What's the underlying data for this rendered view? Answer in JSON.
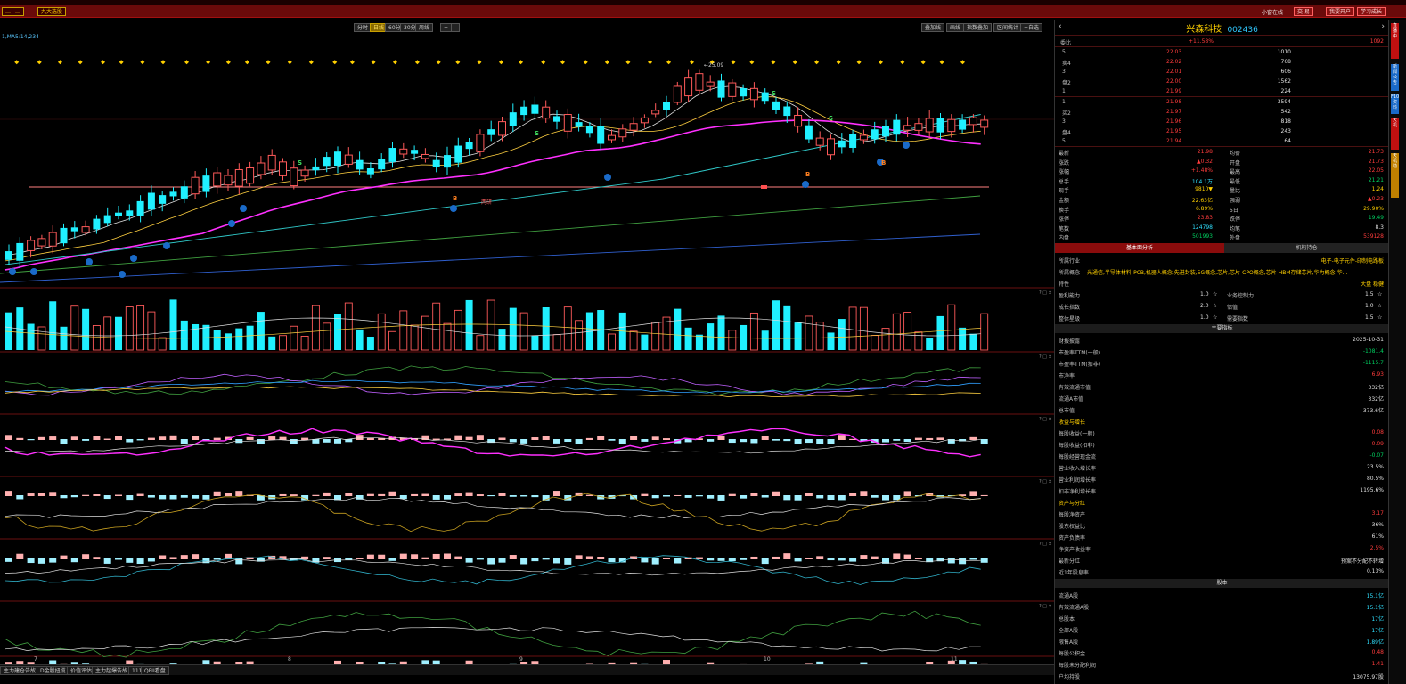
{
  "toolbar": {
    "left_buttons": [
      "…",
      "…",
      "九大选股"
    ],
    "right_status": "小窗在线",
    "right_buttons": [
      "交 易",
      "我要开户",
      "学习成长"
    ]
  },
  "chart_toolbar": {
    "periods": [
      "分时",
      "日线",
      "60分",
      "30分",
      "周线"
    ],
    "active_period": "日线",
    "zoom_in": "+",
    "zoom_out": "-",
    "right_buttons": [
      "叠加线",
      "画线",
      "指数叠加",
      "区间统计",
      "+自选"
    ],
    "ma_label": "1,MA5:14,234",
    "peak_label": "25.09"
  },
  "bottom_tabs": [
    "主力建仓告故",
    "D金股扭缆",
    "价值评估",
    "主力起爆告故",
    "111",
    "QFII看盘"
  ],
  "dates": [
    "7",
    "8",
    "9",
    "10",
    "11"
  ],
  "annotation": "两研",
  "stock": {
    "name": "兴森科技",
    "code": "002436",
    "weibi_label": "委比",
    "weibi": "+11.58%",
    "weibi_diff": "1092",
    "sell_orders": [
      {
        "label": "5",
        "price": "22.03",
        "vol": "1010"
      },
      {
        "label": "卖4",
        "price": "22.02",
        "vol": "768"
      },
      {
        "label": "3",
        "price": "22.01",
        "vol": "606"
      },
      {
        "label": "盘2",
        "price": "22.00",
        "vol": "1562"
      },
      {
        "label": "1",
        "price": "21.99",
        "vol": "224"
      }
    ],
    "buy_orders": [
      {
        "label": "1",
        "price": "21.98",
        "vol": "3594"
      },
      {
        "label": "买2",
        "price": "21.97",
        "vol": "542"
      },
      {
        "label": "3",
        "price": "21.96",
        "vol": "818"
      },
      {
        "label": "盘4",
        "price": "21.95",
        "vol": "243"
      },
      {
        "label": "5",
        "price": "21.94",
        "vol": "64"
      }
    ],
    "quote": [
      {
        "l1": "最新",
        "v1": "21.98",
        "c1": "up",
        "l2": "均价",
        "v2": "21.73",
        "c2": "up"
      },
      {
        "l1": "涨跌",
        "v1": "▲0.32",
        "c1": "up",
        "l2": "开盘",
        "v2": "21.73",
        "c2": "up"
      },
      {
        "l1": "涨幅",
        "v1": "+1.48%",
        "c1": "up",
        "l2": "最高",
        "v2": "22.05",
        "c2": "up"
      },
      {
        "l1": "总手",
        "v1": "104.1万",
        "c1": "cyan",
        "l2": "最低",
        "v2": "21.21",
        "c2": "down"
      },
      {
        "l1": "现手",
        "v1": "9810▼",
        "c1": "yel",
        "l2": "量比",
        "v2": "1.24",
        "c2": "yel"
      },
      {
        "l1": "金额",
        "v1": "22.63亿",
        "c1": "yel",
        "l2": "强弱",
        "v2": "▲0.23",
        "c2": "up"
      },
      {
        "l1": "换手",
        "v1": "6.89%",
        "c1": "yel",
        "l2": "5日",
        "v2": "29.90%",
        "c2": "yel"
      },
      {
        "l1": "涨停",
        "v1": "23.83",
        "c1": "up",
        "l2": "跌停",
        "v2": "19.49",
        "c2": "down"
      },
      {
        "l1": "笔数",
        "v1": "124798",
        "c1": "cyan",
        "l2": "均笔",
        "v2": "8.3",
        "c2": "wht"
      },
      {
        "l1": "内盘",
        "v1": "501993",
        "c1": "down",
        "l2": "外盘",
        "v2": "539128",
        "c2": "up"
      }
    ],
    "tabs": [
      "基本面分析",
      "机构持仓"
    ],
    "industry_label": "所属行业",
    "industry": "电子-电子元件-印制电路板",
    "concept_label": "所属概念",
    "concept": "光通信,半导体材料-PCB,机器人概念,先进封装,5G概念,芯片,芯片-CPO概念,芯片-HBM存储芯片,华为概念-华...",
    "feature_label": "特性",
    "feature": "大盘 稳健",
    "ratings": [
      {
        "l1": "盈利能力",
        "v1": "1.0",
        "l2": "业务控制力",
        "v2": "1.5"
      },
      {
        "l1": "成长指数",
        "v1": "2.0",
        "l2": "估值",
        "v2": "1.0"
      },
      {
        "l1": "整体星级",
        "v1": "1.0",
        "l2": "需要指数",
        "v2": "1.5"
      }
    ],
    "main_metrics_title": "主要指标",
    "report_label": "财报披露",
    "report_date": "2025-10-31",
    "metrics": [
      {
        "l": "市盈率TTM(一般)",
        "v": "-1081.4",
        "c": "down"
      },
      {
        "l": "市盈率TTM(扣非)",
        "v": "-1115.7",
        "c": "down"
      },
      {
        "l": "市净率",
        "v": "6.93",
        "c": "up"
      },
      {
        "l": "有效流通市值",
        "v": "332亿",
        "c": "wht"
      },
      {
        "l": "流通A市值",
        "v": "332亿",
        "c": "wht"
      },
      {
        "l": "总市值",
        "v": "373.6亿",
        "c": "wht"
      }
    ],
    "income_title": "收益与增长",
    "income": [
      {
        "l": "每股收益(一般)",
        "v": "0.08",
        "c": "up"
      },
      {
        "l": "每股收益(扣非)",
        "v": "0.09",
        "c": "up"
      },
      {
        "l": "每股经营现金流",
        "v": "-0.07",
        "c": "down"
      },
      {
        "l": "营业收入增长率",
        "v": "23.5%",
        "c": "wht"
      },
      {
        "l": "营业利润增长率",
        "v": "80.5%",
        "c": "wht"
      },
      {
        "l": "扣非净利增长率",
        "v": "1195.6%",
        "c": "wht"
      }
    ],
    "asset_title": "资产与分红",
    "assets": [
      {
        "l": "每股净资产",
        "v": "3.17",
        "c": "up"
      },
      {
        "l": "股东权益比",
        "v": "36%",
        "c": "wht"
      },
      {
        "l": "资产负债率",
        "v": "61%",
        "c": "wht"
      },
      {
        "l": "净资产收益率",
        "v": "2.5%",
        "c": "up"
      },
      {
        "l": "最新分红",
        "v": "预案不分配不转增",
        "c": "wht"
      },
      {
        "l": "近1年股息率",
        "v": "0.13%",
        "c": "wht"
      }
    ],
    "equity_title": "股本",
    "equity": [
      {
        "l": "流通A股",
        "v": "15.1亿",
        "c": "cyan"
      },
      {
        "l": "有效流通A股",
        "v": "15.1亿",
        "c": "cyan"
      },
      {
        "l": "总股本",
        "v": "17亿",
        "c": "cyan"
      },
      {
        "l": "全部A股",
        "v": "17亿",
        "c": "cyan"
      },
      {
        "l": "限售A股",
        "v": "1.89亿",
        "c": "cyan"
      },
      {
        "l": "每股公积金",
        "v": "0.48",
        "c": "up"
      },
      {
        "l": "每股未分配利润",
        "v": "1.41",
        "c": "up"
      },
      {
        "l": "户均持股",
        "v": "13075.97股",
        "c": "wht"
      }
    ]
  },
  "side_tabs": [
    "直播中",
    "新闻公告",
    "F10资料",
    "天机",
    "天机助"
  ],
  "colors": {
    "up": "#ff3c3c",
    "down": "#00d060",
    "bull_candle": "#ff5a5a",
    "bear_candle": "#20f0ff",
    "ma_magenta": "#ff30ff",
    "accent_yellow": "#ffd000"
  }
}
